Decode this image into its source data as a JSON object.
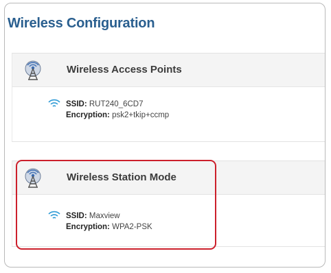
{
  "page": {
    "title": "Wireless Configuration"
  },
  "access_points": {
    "title": "Wireless Access Points",
    "ssid_label": "SSID:",
    "ssid_value": "RUT240_6CD7",
    "encryption_label": "Encryption:",
    "encryption_value": "psk2+tkip+ccmp"
  },
  "station_mode": {
    "title": "Wireless Station Mode",
    "ssid_label": "SSID:",
    "ssid_value": "Maxview",
    "encryption_label": "Encryption:",
    "encryption_value": "WPA2-PSK"
  },
  "colors": {
    "title": "#2a5f8f",
    "highlight": "#cc1f2b",
    "wifi": "#2f9bd6"
  },
  "icons": {
    "section": "antenna-tower-icon",
    "entry": "wifi-icon"
  }
}
